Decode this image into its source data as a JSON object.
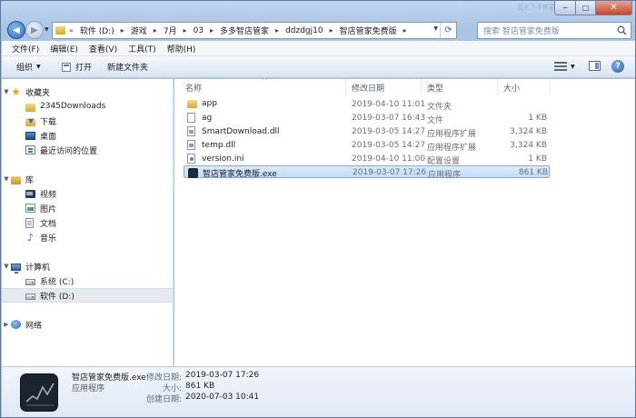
{
  "window": {
    "ghost_title": "蓝天下不需要伞",
    "caption": {
      "minimize": "─",
      "maximize": "□",
      "close": "✕"
    }
  },
  "address": {
    "overflow": "«",
    "crumbs": [
      "软件 (D:)",
      "游戏",
      "7月",
      "03",
      "多多智店管家",
      "ddzdgj10",
      "智店管家免费版"
    ],
    "separator": "▸",
    "search_placeholder": "搜索 智店管家免费版"
  },
  "menu": [
    "文件(F)",
    "编辑(E)",
    "查看(V)",
    "工具(T)",
    "帮助(H)"
  ],
  "toolbar": {
    "organize": "组织",
    "open": "打开",
    "new_folder": "新建文件夹"
  },
  "nav": {
    "favorites": "收藏夹",
    "favorites_items": [
      "2345Downloads",
      "下载",
      "桌面",
      "最近访问的位置"
    ],
    "libraries": "库",
    "libraries_items": [
      "视频",
      "图片",
      "文档",
      "音乐"
    ],
    "computer": "计算机",
    "computer_items": [
      "系统 (C:)",
      "软件 (D:)"
    ],
    "network": "网络"
  },
  "columns": {
    "name": "名称",
    "date": "修改日期",
    "type": "类型",
    "size": "大小"
  },
  "files": [
    {
      "name": "app",
      "date": "2019-04-10 11:01",
      "type": "文件夹",
      "size": "",
      "icon": "folder-icon"
    },
    {
      "name": "ag",
      "date": "2019-03-07 16:43",
      "type": "文件",
      "size": "1 KB",
      "icon": "file-icon"
    },
    {
      "name": "SmartDownload.dll",
      "date": "2019-03-05 14:27",
      "type": "应用程序扩展",
      "size": "3,324 KB",
      "icon": "dll-icon"
    },
    {
      "name": "temp.dll",
      "date": "2019-03-05 14:27",
      "type": "应用程序扩展",
      "size": "3,324 KB",
      "icon": "dll-icon"
    },
    {
      "name": "version.ini",
      "date": "2019-04-10 11:00",
      "type": "配置设置",
      "size": "1 KB",
      "icon": "ini-icon"
    },
    {
      "name": "智店管家免费版.exe",
      "date": "2019-03-07 17:26",
      "type": "应用程序",
      "size": "861 KB",
      "icon": "exe-icon"
    }
  ],
  "details": {
    "name": "智店管家免费版.exe",
    "type": "应用程序",
    "modified_label": "修改日期:",
    "modified": "2019-03-07 17:26",
    "size_label": "大小:",
    "size": "861 KB",
    "created_label": "创建日期:",
    "created": "2020-07-03 10:41"
  },
  "colors": {
    "frame": "#a9c4e4",
    "selection": "#c1dcfa",
    "selection_border": "#84acdd",
    "text_secondary": "#6d6d6d"
  }
}
